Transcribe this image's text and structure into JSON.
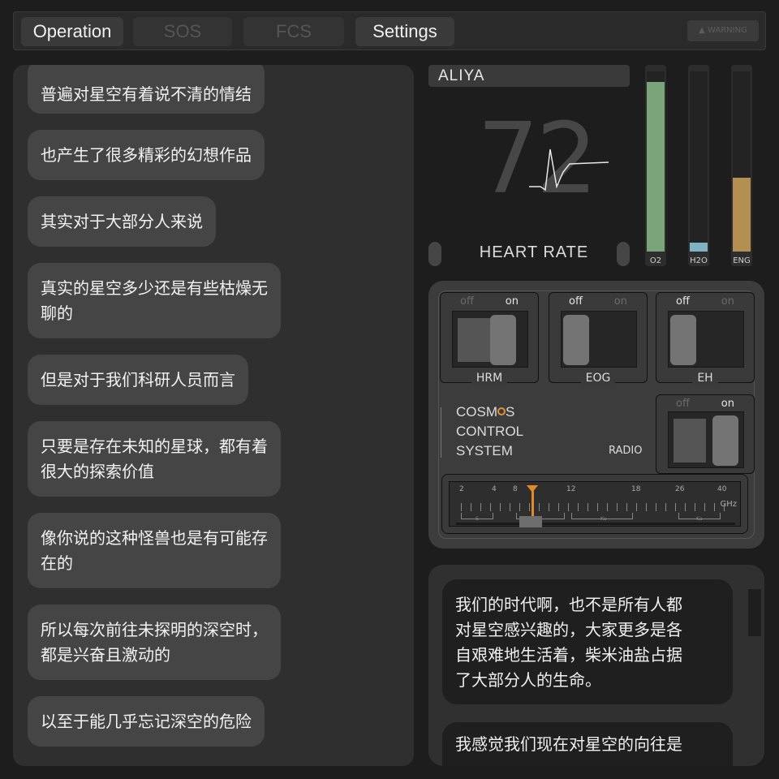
{
  "tabs": [
    {
      "label": "Operation",
      "state": "active"
    },
    {
      "label": "SOS",
      "state": "disabled"
    },
    {
      "label": "FCS",
      "state": "disabled"
    },
    {
      "label": "Settings",
      "state": "active"
    }
  ],
  "warning_label": "WARNING",
  "left_chat": {
    "messages": [
      "普遍对星空有着说不清的情结",
      "也产生了很多精彩的幻想作品",
      "其实对于大部分人来说",
      "真实的星空多少还是有些枯燥无\n聊的",
      "但是对于我们科研人员而言",
      "只要是存在未知的星球，都有着\n很大的探索价值",
      "像你说的这种怪兽也是有可能存\n在的",
      "所以每次前往未探明的深空时，\n都是兴奋且激动的",
      "以至于能几乎忘记深空的危险"
    ]
  },
  "monitor": {
    "name": "ALIYA",
    "heart_rate_value": "72",
    "heart_rate_label": "HEART RATE",
    "gauges": [
      {
        "label": "O2",
        "level": 0.94,
        "color": "#7aa57a"
      },
      {
        "label": "H2O",
        "level": 0.05,
        "color": "#7fb3c4"
      },
      {
        "label": "ENG",
        "level": 0.41,
        "color": "#b38f52"
      }
    ]
  },
  "control_panel": {
    "switches": [
      {
        "name": "HRM",
        "off_label": "off",
        "on_label": "on",
        "state": "on"
      },
      {
        "name": "EOG",
        "off_label": "off",
        "on_label": "on",
        "state": "off"
      },
      {
        "name": "EH",
        "off_label": "off",
        "on_label": "on",
        "state": "off"
      }
    ],
    "radio_switch": {
      "off_label": "off",
      "on_label": "on",
      "state": "on"
    },
    "brand_line1_prefix": "COSM",
    "brand_line1_suffix": "S",
    "brand_line2": "CONTROL",
    "brand_line3": "SYSTEM",
    "radio_label": "RADIO",
    "tuner": {
      "tick_labels": [
        "2",
        "4",
        "8",
        "12",
        "18",
        "26",
        "40"
      ],
      "unit": "GHz",
      "bands": [
        "S",
        "X",
        "Ku",
        "Ka"
      ],
      "accent_color": "#e08a2a"
    }
  },
  "right_chat": {
    "messages": [
      "我们的时代啊，也不是所有人都\n对星空感兴趣的，大家更多是各\n自艰难地生活着，柴米油盐占据\n了大部分人的生命。",
      "我感觉我们现在对星空的向往是"
    ]
  }
}
